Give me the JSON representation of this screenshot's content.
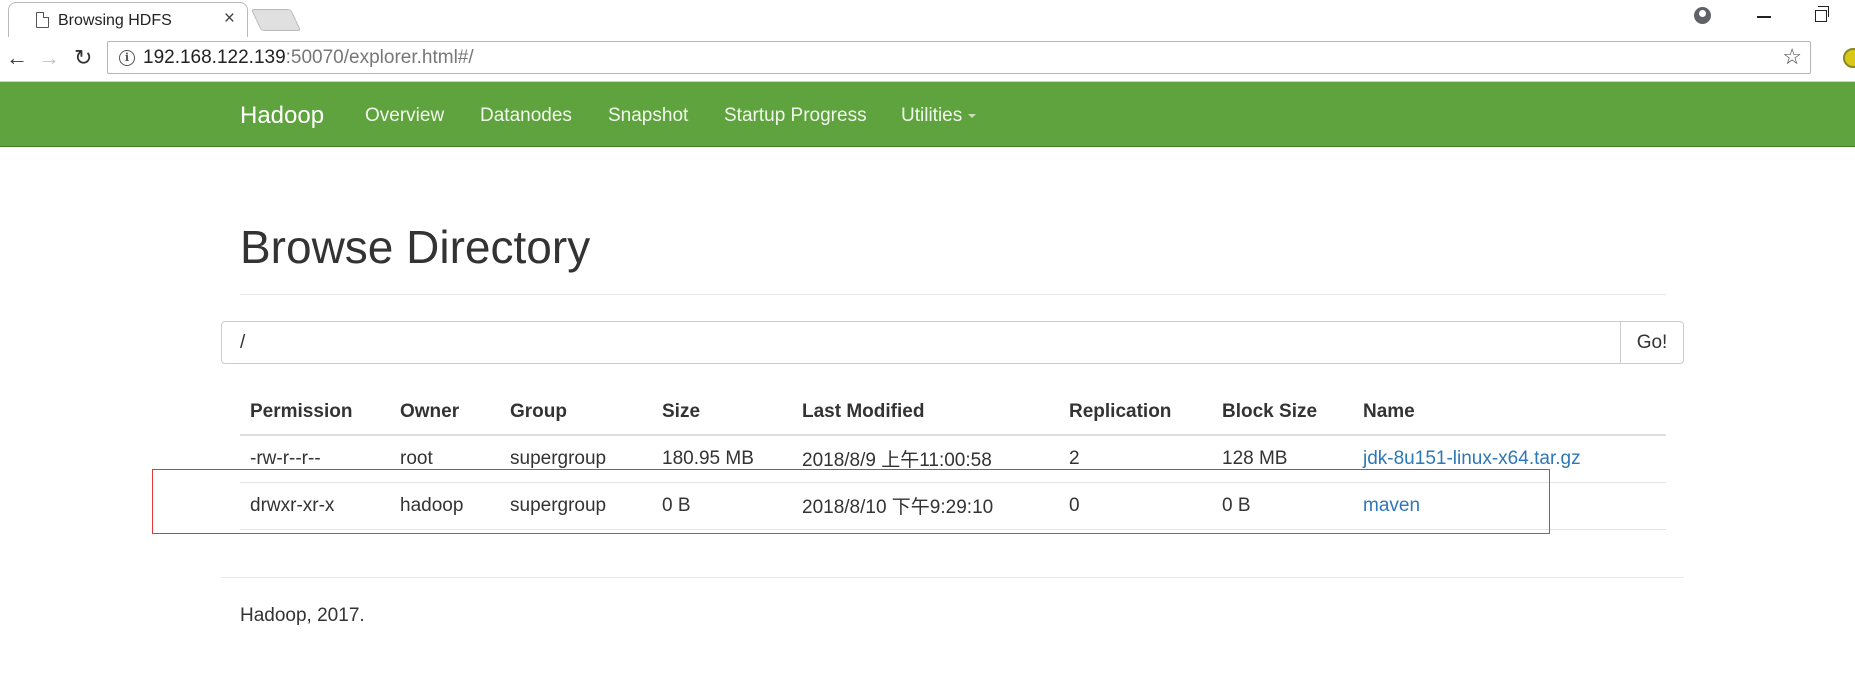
{
  "browser": {
    "tab_title": "Browsing HDFS",
    "tab_close": "×",
    "url_host": "192.168.122.139",
    "url_rest": ":50070/explorer.html#/",
    "nav": {
      "back": "←",
      "forward": "→",
      "reload": "↻"
    },
    "star": "☆"
  },
  "navbar": {
    "brand": "Hadoop",
    "links": [
      "Overview",
      "Datanodes",
      "Snapshot",
      "Startup Progress",
      "Utilities"
    ]
  },
  "main": {
    "title": "Browse Directory",
    "path_value": "/",
    "go_label": "Go!",
    "columns": [
      "Permission",
      "Owner",
      "Group",
      "Size",
      "Last Modified",
      "Replication",
      "Block Size",
      "Name"
    ],
    "rows": [
      [
        "-rw-r--r--",
        "root",
        "supergroup",
        "180.95 MB",
        "2018/8/9 上午11:00:58",
        "2",
        "128 MB",
        "jdk-8u151-linux-x64.tar.gz"
      ],
      [
        "drwxr-xr-x",
        "hadoop",
        "supergroup",
        "0 B",
        "2018/8/10 下午9:29:10",
        "0",
        "0 B",
        "maven"
      ]
    ]
  },
  "footer": {
    "text": "Hadoop, 2017."
  },
  "colors": {
    "navbar": "#5fa33e",
    "link": "#2e77b8",
    "highlight": "#e03a3a"
  }
}
